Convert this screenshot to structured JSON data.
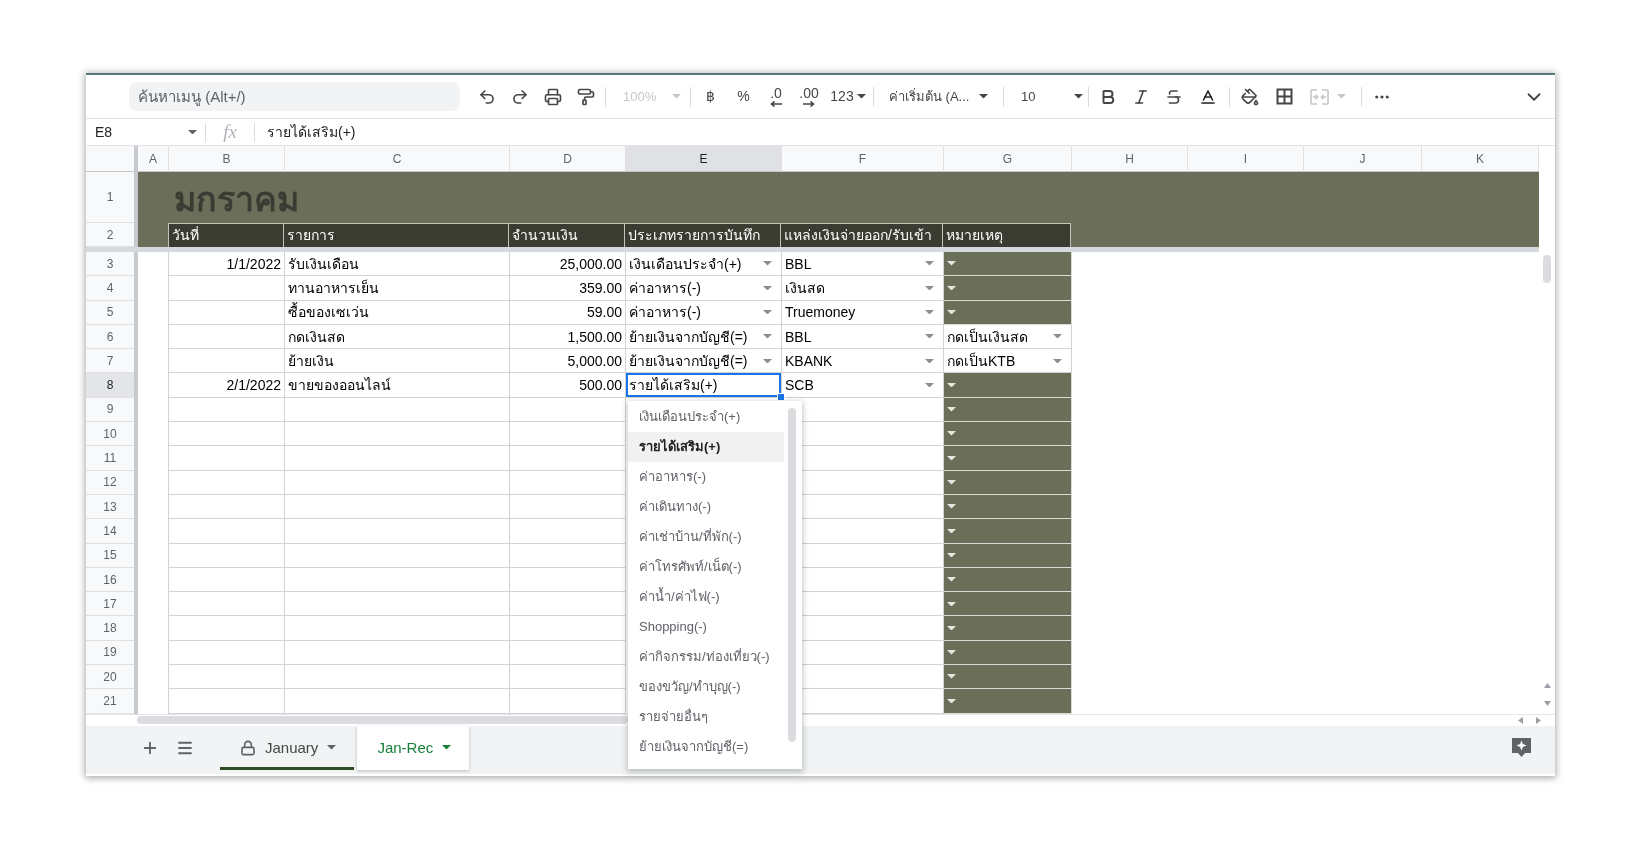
{
  "toolbar": {
    "search": {
      "placeholder": "ค้นหาเมนู (Alt+/)"
    },
    "zoom": {
      "label": "100%",
      "disabled": true
    },
    "format_buttons": [
      {
        "kind": "currency",
        "label": "฿"
      },
      {
        "kind": "percent",
        "label": "%"
      },
      {
        "kind": "decrease_decimals",
        "label": ".0"
      },
      {
        "kind": "increase_decimals",
        "label": ".00"
      },
      {
        "kind": "more_formats",
        "label": "123"
      }
    ],
    "font": "ค่าเริ่มต้น (A...",
    "font_size": "10",
    "merge": {
      "disabled": true
    }
  },
  "formula_bar": {
    "cell": "E8",
    "fx": "fx",
    "content": "รายได้เสริม(+)"
  },
  "columns": [
    {
      "label": "A",
      "selected": false
    },
    {
      "label": "B",
      "selected": false
    },
    {
      "label": "C",
      "selected": false
    },
    {
      "label": "D",
      "selected": false
    },
    {
      "label": "E",
      "selected": true
    },
    {
      "label": "F",
      "selected": false
    },
    {
      "label": "G",
      "selected": false
    },
    {
      "label": "H",
      "selected": false
    },
    {
      "label": "I",
      "selected": false
    },
    {
      "label": "J",
      "selected": false
    },
    {
      "label": "K",
      "selected": false
    }
  ],
  "sheet": {
    "title_row": {
      "number": "1",
      "selected": false,
      "title": "มกราคม"
    },
    "header_row": {
      "number": "2",
      "selected": false,
      "labels": [
        "วันที่",
        "รายการ",
        "จำนวนเงิน",
        "ประเภทรายการบันทึก",
        "แหล่งเงินจ่ายออก/รับเข้า",
        "หมายเหตุ"
      ]
    },
    "rows": [
      {
        "number": "3",
        "selected": false,
        "date": "1/1/2022",
        "item": "รับเงินเดือน",
        "amount": "25,000.00",
        "type": "เงินเดือนประจำ(+)",
        "type_active": false,
        "source": "BBL",
        "note_shaded": true
      },
      {
        "number": "4",
        "selected": false,
        "item": "ทานอาหารเย็น",
        "amount": "359.00",
        "type": "ค่าอาหาร(-)",
        "type_active": false,
        "source": "เงินสด",
        "note_shaded": true
      },
      {
        "number": "5",
        "selected": false,
        "item": "ซื้อของเซเว่น",
        "amount": "59.00",
        "type": "ค่าอาหาร(-)",
        "type_active": false,
        "source": "Truemoney",
        "note_shaded": true
      },
      {
        "number": "6",
        "selected": false,
        "item": "กดเงินสด",
        "amount": "1,500.00",
        "type": "ย้ายเงินจากบัญชี(=)",
        "type_active": false,
        "source": "BBL",
        "note": "กดเป็นเงินสด",
        "note_shaded": false
      },
      {
        "number": "7",
        "selected": false,
        "item": "ย้ายเงิน",
        "amount": "5,000.00",
        "type": "ย้ายเงินจากบัญชี(=)",
        "type_active": false,
        "source": "KBANK",
        "note": "กดเป็นKTB",
        "note_shaded": false
      },
      {
        "number": "8",
        "selected": true,
        "date": "2/1/2022",
        "item": "ขายของออนไลน์",
        "amount": "500.00",
        "type": "รายได้เสริม(+)",
        "type_active": true,
        "source": "SCB",
        "note_shaded": true
      },
      {
        "number": "9",
        "selected": false,
        "type_active": false,
        "note_shaded": true
      },
      {
        "number": "10",
        "selected": false,
        "type_active": false,
        "note_shaded": true
      },
      {
        "number": "11",
        "selected": false,
        "type_active": false,
        "note_shaded": true
      },
      {
        "number": "12",
        "selected": false,
        "type_active": false,
        "note_shaded": true
      },
      {
        "number": "13",
        "selected": false,
        "type_active": false,
        "note_shaded": true
      },
      {
        "number": "14",
        "selected": false,
        "type_active": false,
        "note_shaded": true
      },
      {
        "number": "15",
        "selected": false,
        "type_active": false,
        "note_shaded": true
      },
      {
        "number": "16",
        "selected": false,
        "type_active": false,
        "note_shaded": true
      },
      {
        "number": "17",
        "selected": false,
        "type_active": false,
        "note_shaded": true
      },
      {
        "number": "18",
        "selected": false,
        "type_active": false,
        "note_shaded": true
      },
      {
        "number": "19",
        "selected": false,
        "type_active": false,
        "note_shaded": true
      },
      {
        "number": "20",
        "selected": false,
        "type_active": false,
        "note_shaded": true
      },
      {
        "number": "21",
        "selected": false,
        "type_active": false,
        "note_shaded": true
      }
    ]
  },
  "dropdown": {
    "items": [
      {
        "label": "เงินเดือนประจำ(+)",
        "selected": false
      },
      {
        "label": "รายได้เสริม(+)",
        "selected": true
      },
      {
        "label": "ค่าอาหาร(-)",
        "selected": false
      },
      {
        "label": "ค่าเดินทาง(-)",
        "selected": false
      },
      {
        "label": "ค่าเช่าบ้าน/ที่พัก(-)",
        "selected": false
      },
      {
        "label": "ค่าโทรศัพท์/เน็ต(-)",
        "selected": false
      },
      {
        "label": "ค่าน้ำ/ค่าไฟ(-)",
        "selected": false
      },
      {
        "label": "Shopping(-)",
        "selected": false
      },
      {
        "label": "ค่ากิจกรรม/ท่องเที่ยว(-)",
        "selected": false
      },
      {
        "label": "ของขวัญ/ทำบุญ(-)",
        "selected": false
      },
      {
        "label": "รายจ่ายอื่นๆ",
        "selected": false
      },
      {
        "label": "ย้ายเงินจากบัญชี(=)",
        "selected": false
      }
    ]
  },
  "sheet_tabs": {
    "tabs": [
      {
        "label": "January",
        "locked": true,
        "selected": false,
        "color": "#2f4a22"
      },
      {
        "label": "Jan-Rec",
        "locked": false,
        "selected": true
      }
    ]
  }
}
